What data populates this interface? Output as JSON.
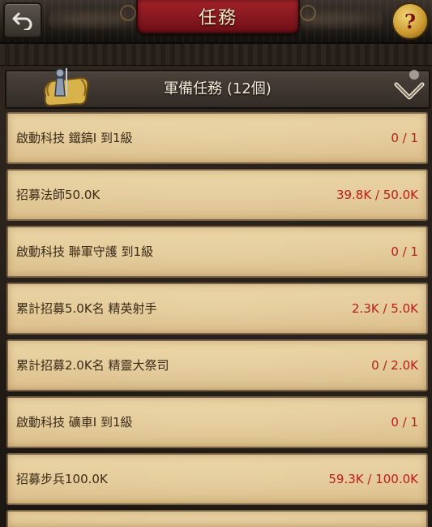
{
  "header": {
    "title": "任務"
  },
  "section": {
    "title": "軍備任務 (12個)"
  },
  "quests": [
    {
      "name": "啟動科技 鐵鎬I 到1級",
      "progress": "0 / 1"
    },
    {
      "name": "招募法師50.0K",
      "progress": "39.8K / 50.0K"
    },
    {
      "name": "啟動科技 聯軍守護 到1級",
      "progress": "0 / 1"
    },
    {
      "name": "累計招募5.0K名 精英射手",
      "progress": "2.3K / 5.0K"
    },
    {
      "name": "累計招募2.0K名 精靈大祭司",
      "progress": "0 / 2.0K"
    },
    {
      "name": "啟動科技 礦車I 到1級",
      "progress": "0 / 1"
    },
    {
      "name": "招募步兵100.0K",
      "progress": "59.3K / 100.0K"
    }
  ],
  "icons": {
    "back": "back-arrow-icon",
    "help": "help-question-icon",
    "section": "scroll-knight-icon",
    "collapse": "chevron-down-icon"
  },
  "colors": {
    "title_plate": "#8f1a21",
    "progress_text": "#b52018",
    "quest_text": "#3a2a18",
    "parchment": "#e6cd9b"
  }
}
